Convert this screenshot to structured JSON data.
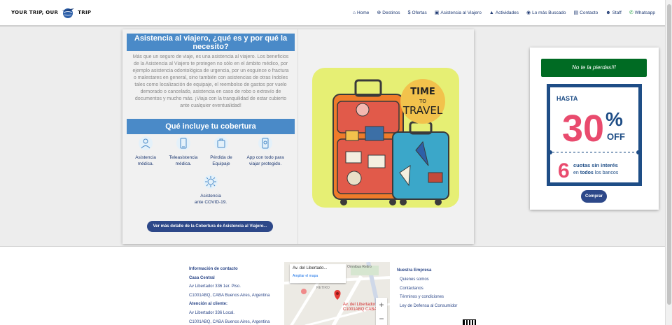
{
  "header": {
    "logo_left": "YOUR TRIP, OUR",
    "logo_right": "TRIP",
    "nav": [
      {
        "icon": "home-icon",
        "glyph": "⌂",
        "label": "Home"
      },
      {
        "icon": "globe-icon",
        "glyph": "⊕",
        "label": "Destinos"
      },
      {
        "icon": "dollar-icon",
        "glyph": "$",
        "label": "Ofertas"
      },
      {
        "icon": "suitcase-icon",
        "glyph": "▣",
        "label": "Asistencia al Viajero"
      },
      {
        "icon": "mountain-icon",
        "glyph": "▲",
        "label": "Actividades"
      },
      {
        "icon": "eye-icon",
        "glyph": "◉",
        "label": "Lo más Buscado"
      },
      {
        "icon": "contact-card-icon",
        "glyph": "▤",
        "label": "Contacto"
      },
      {
        "icon": "user-plus-icon",
        "glyph": "☻",
        "label": "Staff"
      },
      {
        "icon": "whatsapp-icon",
        "glyph": "✆",
        "label": "Whatsapp"
      }
    ]
  },
  "main": {
    "title": "Asistencia al viajero, ¿qué es y por qué la necesito?",
    "intro": "Más que un seguro de viaje, es una asistencia al viajero. Los beneficios de la Asistencia al Viajero te protegen no sólo en el ámbito médico, por ejemplo asistencia odontológica de urgencia, por un esguince o fractura o malestares en general, sino también con asistencias de otras índoles tales como localización de equipaje, el reembolso de gastos por vuelo demorado o cancelado, asistencia en caso de robo o extravío de documentos y mucho más. ¡Viaja con la tranquilidad de estar cubierto ante cualquier eventualidad!",
    "coverage_title": "Qué incluye tu cobertura",
    "coverage": [
      {
        "icon": "doctor-icon",
        "line1": "Asistencia",
        "line2": "médica."
      },
      {
        "icon": "phone-doctor-icon",
        "line1": "Teleasistencia",
        "line2": "médica."
      },
      {
        "icon": "luggage-icon",
        "line1": "Pérdida de",
        "line2": "Equipaje"
      },
      {
        "icon": "mobile-app-icon",
        "line1": "App con todo para",
        "line2": "viajar protegido."
      },
      {
        "icon": "virus-icon",
        "line1": "Asistencia",
        "line2": "ante COVID-19."
      }
    ],
    "cta": "Ver más detalle de la Cobertura de Asistencia al Viajero...",
    "image_text": {
      "line1": "TIME",
      "line2": "TO",
      "line3": "TRAVEL"
    }
  },
  "promo": {
    "heading": "No te la pierdas!!!",
    "hasta": "HASTA",
    "percent": "30",
    "pct_sign": "%",
    "off": "OFF",
    "cuotas_num": "6",
    "cuotas_line1": "cuotas sin interés",
    "cuotas_line2_prefix": "en",
    "cuotas_line2_bold": "todos",
    "cuotas_line2_suffix": "los bancos",
    "button": "Comprar"
  },
  "footer": {
    "contact_title": "Información de contacto",
    "central_title": "Casa Central",
    "central_addr1": "Av Libertador 336 1er. Piso.",
    "central_addr2": "C1001ABQ, CABA Buenos Aires, Argentina",
    "client_title": "Atención al cliente:",
    "client_addr1": "Av Libertador 336 Local.",
    "client_addr2": "C1001ABQ, CABA Buenos Aires, Argentina",
    "map_title": "Av. del Libertado...",
    "map_link": "Ampliar el mapa",
    "map_pin_line1": "Av. del Libertador 336",
    "map_pin_line2": "C1001ABQ CABA",
    "map_street1": "Omnibus Retiro",
    "map_street2": "RETIRO",
    "links_title": "Nuestra Empresa",
    "links": [
      "Quienes somos",
      "Contáctanos",
      "Términos y condiciones",
      "Ley de Defensa al Consumidor"
    ]
  }
}
